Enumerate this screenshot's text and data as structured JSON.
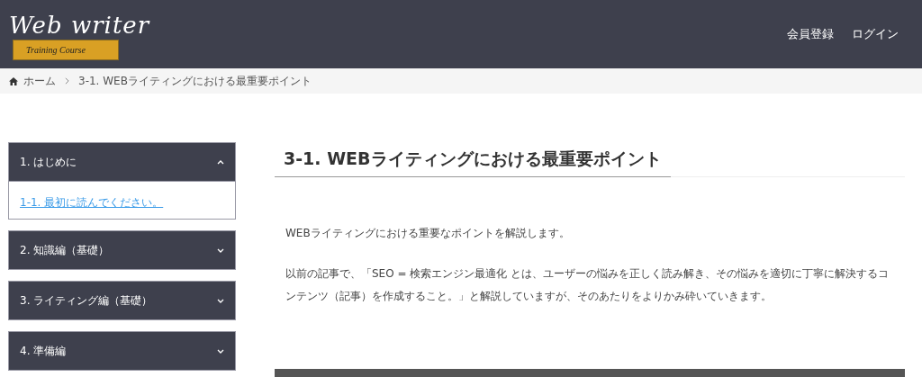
{
  "header": {
    "logo": {
      "title": "Web writer",
      "subtitle": "Training Course"
    },
    "nav": [
      "会員登録",
      "ログイン"
    ]
  },
  "breadcrumb": [
    "ホーム",
    "3-1. WEBライティングにおける最重要ポイント"
  ],
  "sidebar": {
    "items": [
      {
        "label": "1. はじめに",
        "expanded": true,
        "children": [
          "1-1. 最初に読んでください。"
        ]
      },
      {
        "label": "2. 知識編（基礎）",
        "expanded": false
      },
      {
        "label": "3. ライティング編（基礎）",
        "expanded": false
      },
      {
        "label": "4. 準備編",
        "expanded": false
      }
    ]
  },
  "article": {
    "title": "3-1. WEBライティングにおける最重要ポイント",
    "paragraphs": [
      "WEBライティングにおける重要なポイントを解説します。",
      "以前の記事で、「SEO = 検索エンジン最適化 とは、ユーザーの悩みを正しく読み解き、その悩みを適切に丁寧に解決するコンテンツ（記事）を作成すること。」と解説していますが、そのあたりをよりかみ砕いていきます。"
    ]
  }
}
